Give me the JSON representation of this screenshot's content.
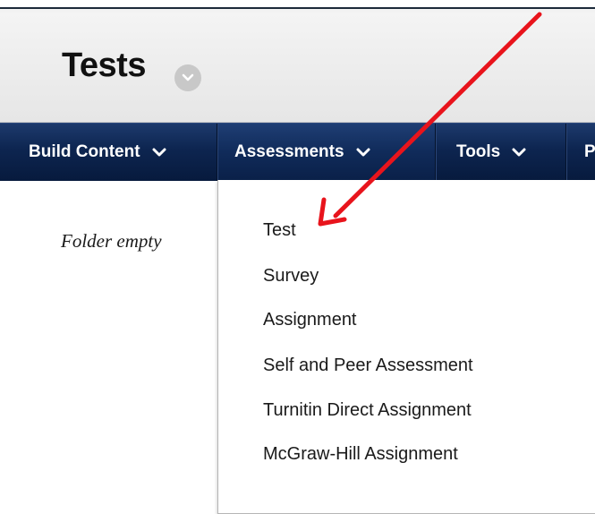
{
  "page": {
    "title": "Tests"
  },
  "nav": {
    "build_content": "Build Content",
    "assessments": "Assessments",
    "tools": "Tools",
    "partial": "P"
  },
  "content": {
    "empty_message": "Folder empty"
  },
  "assessments_menu": {
    "items": [
      "Test",
      "Survey",
      "Assignment",
      "Self and Peer Assessment",
      "Turnitin Direct Assignment",
      "McGraw-Hill Assignment"
    ]
  },
  "annotation": {
    "arrow_color": "#e8141c",
    "target": "Test"
  },
  "colors": {
    "nav_bg": "#0d2550",
    "header_bg": "#eeeeee"
  }
}
